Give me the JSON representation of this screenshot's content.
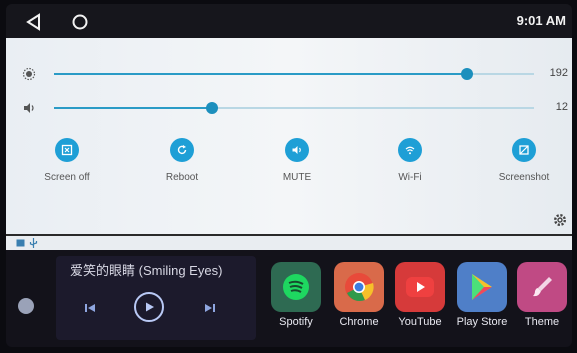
{
  "status_bar": {
    "time": "9:01 AM",
    "back_icon": "back-triangle-icon",
    "home_icon": "home-circle-icon"
  },
  "quick_panel": {
    "brightness": {
      "icon": "brightness-icon",
      "value": "192",
      "level": 0.86
    },
    "volume": {
      "icon": "volume-icon",
      "value": "12",
      "level": 0.33
    },
    "tiles": [
      {
        "label": "Screen off",
        "icon": "screen-off-icon"
      },
      {
        "label": "Reboot",
        "icon": "reboot-icon"
      },
      {
        "label": "MUTE",
        "icon": "mute-icon"
      },
      {
        "label": "Wi-Fi",
        "icon": "wifi-icon"
      },
      {
        "label": "Screenshot",
        "icon": "screenshot-icon"
      }
    ],
    "settings_icon": "gear-icon",
    "accent": "#1e9fd6"
  },
  "notification_strip": {
    "icons": [
      "image-icon",
      "usb-icon"
    ]
  },
  "media": {
    "song_title": "爱笑的眼睛 (Smiling Eyes)"
  },
  "apps": [
    {
      "label": "Spotify",
      "color": "#2b7f4a"
    },
    {
      "label": "Chrome",
      "color": "#d8d8dc"
    },
    {
      "label": "YouTube",
      "color": "#d93b3b"
    },
    {
      "label": "Play Store",
      "color": "#3a6fb8"
    },
    {
      "label": "Theme",
      "color": "#c0437a"
    }
  ]
}
